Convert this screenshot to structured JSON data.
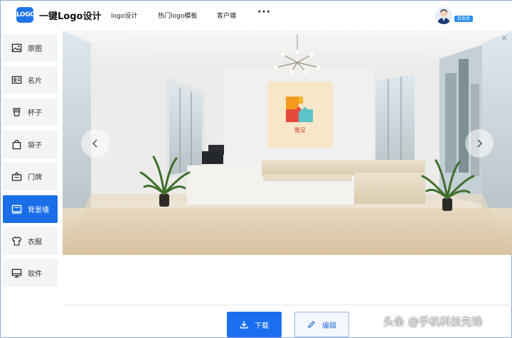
{
  "header": {
    "logo_text": "LOGO",
    "brand": "一键Logo设计",
    "nav": [
      "logo设计",
      "热门logo模板",
      "客户端"
    ],
    "more": "···",
    "vip_badge": "月会员"
  },
  "sidebar": {
    "items": [
      {
        "label": "原图",
        "icon": "image-icon"
      },
      {
        "label": "名片",
        "icon": "card-icon"
      },
      {
        "label": "杯子",
        "icon": "cup-icon"
      },
      {
        "label": "袋子",
        "icon": "bag-icon"
      },
      {
        "label": "门牌",
        "icon": "doorplate-icon"
      },
      {
        "label": "背景墙",
        "icon": "wall-icon",
        "active": true
      },
      {
        "label": "衣服",
        "icon": "shirt-icon"
      },
      {
        "label": "软件",
        "icon": "monitor-icon"
      }
    ]
  },
  "scene": {
    "logo_name": "雅足"
  },
  "actions": {
    "download": "下载",
    "edit": "编辑"
  },
  "watermark": "头条 @手机科技先锋",
  "colors": {
    "accent": "#1a6ee8",
    "logo_orange": "#f39a1e",
    "logo_red": "#e54b3c",
    "logo_teal": "#5cc3c8"
  }
}
